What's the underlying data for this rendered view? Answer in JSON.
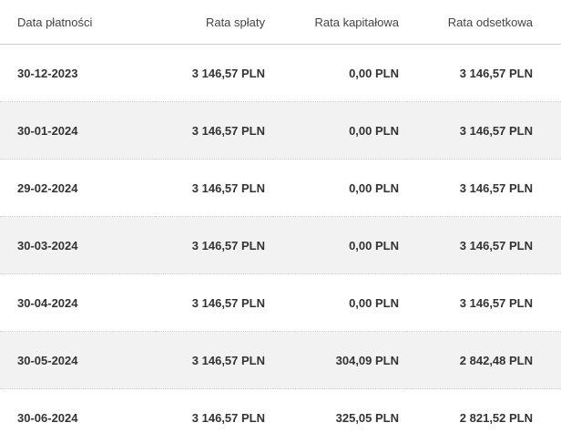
{
  "table": {
    "headers": [
      "Data płatności",
      "Rata spłaty",
      "Rata kapitałowa",
      "Rata odsetkowa"
    ],
    "rows": [
      {
        "date": "30-12-2023",
        "installment": "3 146,57 PLN",
        "principal": "0,00 PLN",
        "interest": "3 146,57 PLN"
      },
      {
        "date": "30-01-2024",
        "installment": "3 146,57 PLN",
        "principal": "0,00 PLN",
        "interest": "3 146,57 PLN"
      },
      {
        "date": "29-02-2024",
        "installment": "3 146,57 PLN",
        "principal": "0,00 PLN",
        "interest": "3 146,57 PLN"
      },
      {
        "date": "30-03-2024",
        "installment": "3 146,57 PLN",
        "principal": "0,00 PLN",
        "interest": "3 146,57 PLN"
      },
      {
        "date": "30-04-2024",
        "installment": "3 146,57 PLN",
        "principal": "0,00 PLN",
        "interest": "3 146,57 PLN"
      },
      {
        "date": "30-05-2024",
        "installment": "3 146,57 PLN",
        "principal": "304,09 PLN",
        "interest": "2 842,48 PLN"
      },
      {
        "date": "30-06-2024",
        "installment": "3 146,57 PLN",
        "principal": "325,05 PLN",
        "interest": "2 821,52 PLN"
      }
    ]
  }
}
